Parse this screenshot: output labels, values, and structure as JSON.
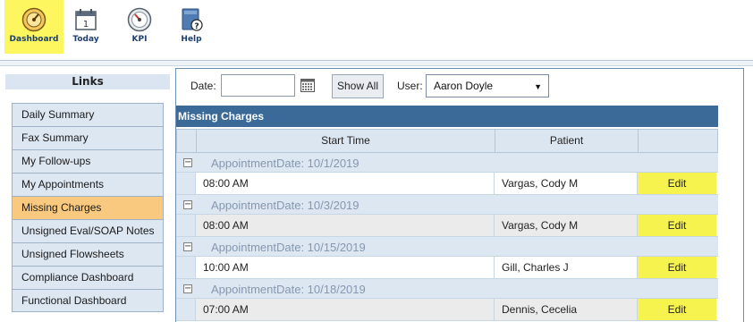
{
  "toolbar": {
    "items": [
      {
        "label": "Dashboard",
        "icon": "dashboard-gauge-icon",
        "active": true
      },
      {
        "label": "Today",
        "icon": "calendar-icon",
        "active": false
      },
      {
        "label": "KPI",
        "icon": "speedometer-icon",
        "active": false
      },
      {
        "label": "Help",
        "icon": "help-book-icon",
        "active": false
      }
    ]
  },
  "sidebar": {
    "title": "Links",
    "items": [
      {
        "label": "Daily Summary"
      },
      {
        "label": "Fax Summary"
      },
      {
        "label": "My Follow-ups"
      },
      {
        "label": "My Appointments"
      },
      {
        "label": "Missing Charges"
      },
      {
        "label": "Unsigned Eval/SOAP Notes"
      },
      {
        "label": "Unsigned Flowsheets"
      },
      {
        "label": "Compliance Dashboard"
      },
      {
        "label": "Functional Dashboard"
      }
    ],
    "selected": "Missing Charges"
  },
  "filters": {
    "date_label": "Date:",
    "date_value": "",
    "show_all_label": "Show All",
    "user_label": "User:",
    "user_value": "Aaron Doyle"
  },
  "grid": {
    "title": "Missing Charges",
    "columns": [
      "Start Time",
      "Patient",
      ""
    ],
    "groups": [
      {
        "label": "AppointmentDate: 10/1/2019",
        "rows": [
          {
            "start_time": "08:00 AM",
            "patient": "Vargas, Cody M",
            "action": "Edit"
          }
        ]
      },
      {
        "label": "AppointmentDate: 10/3/2019",
        "rows": [
          {
            "start_time": "08:00 AM",
            "patient": "Vargas, Cody M",
            "action": "Edit"
          }
        ]
      },
      {
        "label": "AppointmentDate: 10/15/2019",
        "rows": [
          {
            "start_time": "10:00 AM",
            "patient": "Gill, Charles J",
            "action": "Edit"
          }
        ]
      },
      {
        "label": "AppointmentDate: 10/18/2019",
        "rows": [
          {
            "start_time": "07:00 AM",
            "patient": "Dennis, Cecelia",
            "action": "Edit"
          }
        ]
      }
    ]
  },
  "colors": {
    "active_tool": "#fdf65e",
    "grid_header": "#3b6a98",
    "selected_link": "#f8c97e",
    "edit_highlight": "#f6f24e"
  }
}
